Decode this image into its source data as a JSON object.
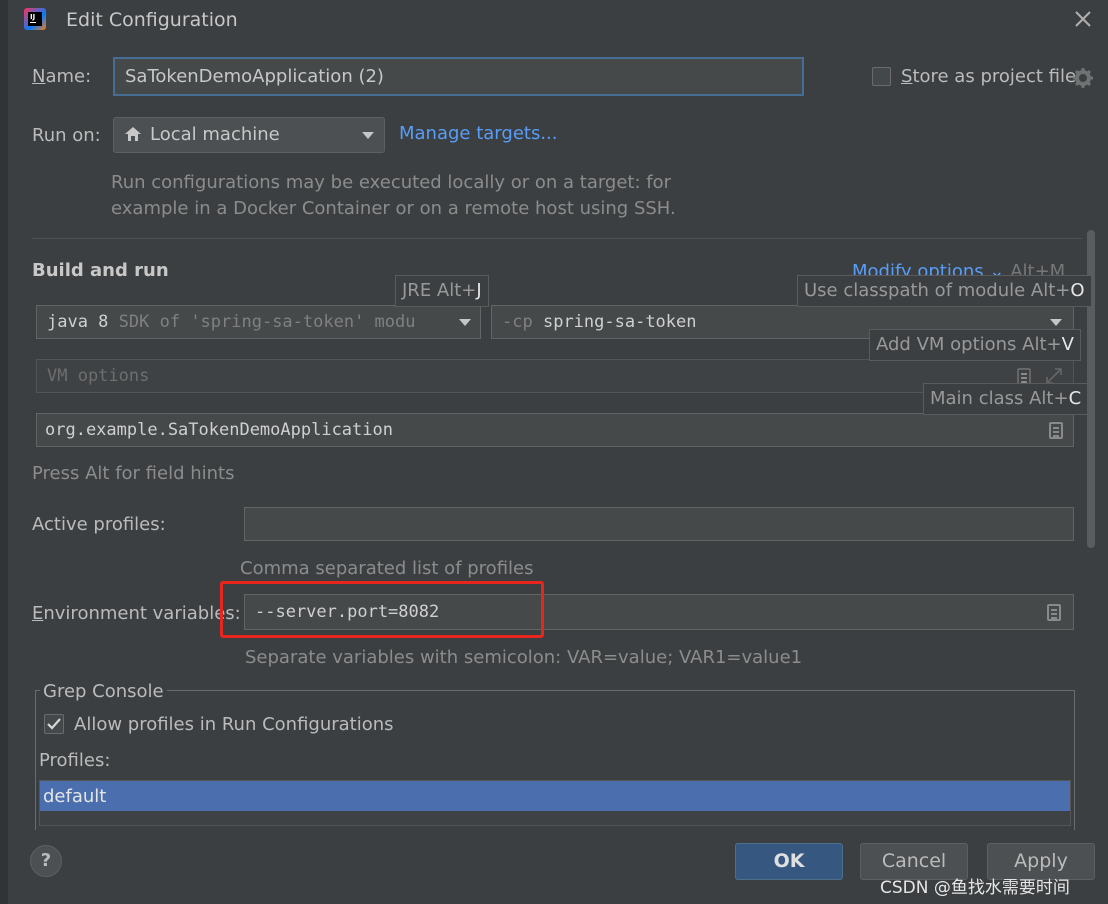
{
  "window": {
    "title": "Edit Configuration"
  },
  "name": {
    "label_pre": "",
    "label_ul": "N",
    "label_post": "ame:",
    "value": "SaTokenDemoApplication (2)"
  },
  "store": {
    "label_ul": "S",
    "label_post": "tore as project file"
  },
  "run_on": {
    "label": "Run on:",
    "value": "Local machine",
    "manage": "Manage targets...",
    "desc_line1": "Run configurations may be executed locally or on a target: for",
    "desc_line2": "example in a Docker Container or on a remote host using SSH."
  },
  "build": {
    "title": "Build and run",
    "modify": "Modify options",
    "modify_key": "Alt+M",
    "jre_prefix": "java 8",
    "jre_suffix": "SDK of 'spring-sa-token' modu",
    "cp_prefix": "-cp",
    "cp_value": "spring-sa-token",
    "vm_placeholder": "VM options",
    "main_class": "org.example.SaTokenDemoApplication",
    "field_hints": "Press Alt for field hints"
  },
  "tooltips": {
    "jre": {
      "text": "JRE Alt+",
      "key": "J"
    },
    "classpath": {
      "text": "Use classpath of module Alt+",
      "key": "O"
    },
    "vm": {
      "text": "Add VM options Alt+",
      "key": "V"
    },
    "main": {
      "text": "Main class Alt+",
      "key": "C"
    }
  },
  "profiles": {
    "label": "Active profiles:",
    "value": "",
    "hint": "Comma separated list of profiles"
  },
  "env": {
    "label_ul": "E",
    "label_post": "nvironment variables:",
    "value": "--server.port=8082",
    "hint": "Separate variables with semicolon: VAR=value; VAR1=value1"
  },
  "grep": {
    "title": "Grep Console",
    "allow": "Allow profiles in Run Configurations",
    "allow_checked": true,
    "profiles_label": "Profiles:",
    "profiles": [
      "default"
    ]
  },
  "buttons": {
    "help": "?",
    "ok": "OK",
    "cancel": "Cancel",
    "apply": "Apply"
  },
  "watermark": "CSDN @鱼找水需要时间",
  "colors": {
    "accent": "#4b6eaf",
    "link": "#589df6",
    "highlight": "#e8261e",
    "selection": "#4b6eaf"
  }
}
